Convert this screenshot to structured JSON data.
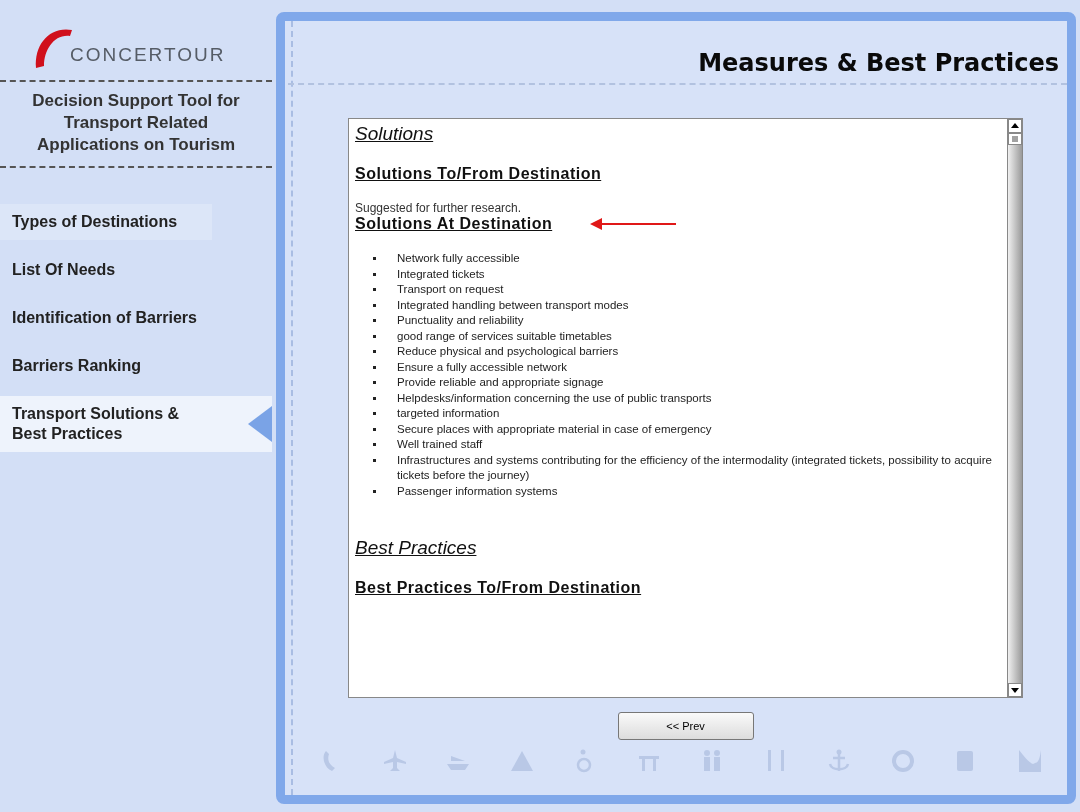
{
  "logo": {
    "text": "CONCERTOUR"
  },
  "subtitle": "Decision Support Tool for Transport Related Applications on Tourism",
  "menu": [
    {
      "label": "Types of Destinations",
      "selected": false
    },
    {
      "label": "List Of Needs",
      "selected": false
    },
    {
      "label": "Identification of Barriers",
      "selected": false
    },
    {
      "label": "Barriers Ranking",
      "selected": false
    },
    {
      "label": "Transport Solutions & Best Practices",
      "selected": true
    }
  ],
  "page_title": "Measures & Best Practices",
  "content": [
    {
      "kind": "heading",
      "text": "Solutions"
    },
    {
      "kind": "subheading",
      "text": "Solutions To/From Destination"
    },
    {
      "kind": "note",
      "text": "Suggested for further research."
    },
    {
      "kind": "subheading",
      "text": "Solutions At Destination",
      "arrow": true
    },
    {
      "kind": "list",
      "items": [
        "Network fully accessible",
        "Integrated tickets",
        "Transport on request",
        "Integrated handling between transport modes",
        "Punctuality and reliability",
        "good range of services suitable timetables",
        "Reduce physical and psychological barriers",
        "Ensure a fully accessible network",
        "Provide reliable and appropriate signage",
        "Helpdesks/information concerning the use of public transports",
        "targeted information",
        "Secure places with appropriate material in case of emergency",
        "Well trained staff",
        "Infrastructures and systems contributing for the efficiency of the intermodality (integrated tickets, possibility to acquire tickets before the journey)",
        "Passenger information systems"
      ]
    },
    {
      "kind": "heading",
      "text": "Best Practices"
    },
    {
      "kind": "subheading",
      "text": "Best Practices To/From Destination"
    }
  ],
  "buttons": [
    {
      "label": "<< Prev"
    }
  ]
}
